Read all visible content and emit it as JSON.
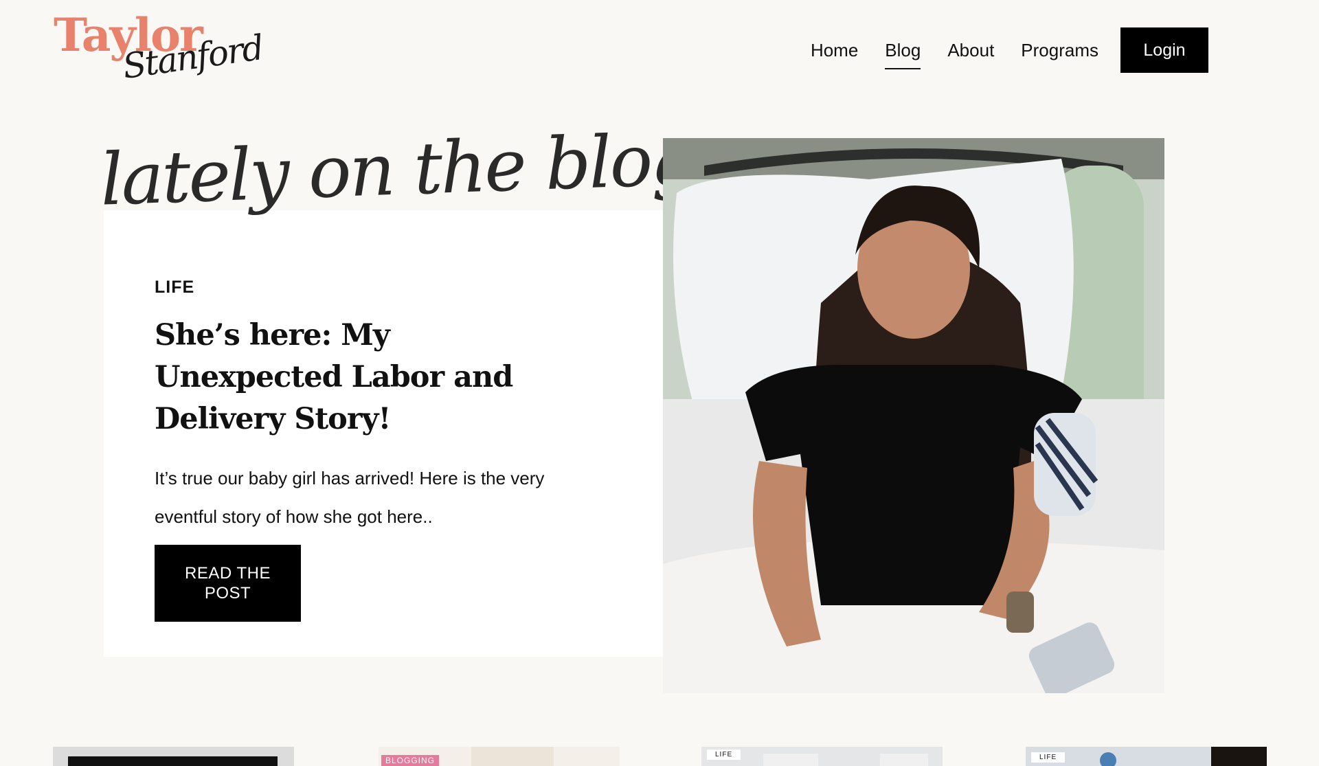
{
  "brand": {
    "logo_top": "Taylor",
    "logo_script": "Stanford",
    "accent_color": "#e8826c"
  },
  "nav": {
    "items": [
      {
        "label": "Home",
        "active": false
      },
      {
        "label": "Blog",
        "active": true
      },
      {
        "label": "About",
        "active": false
      },
      {
        "label": "Programs",
        "active": false
      }
    ],
    "login_label": "Login"
  },
  "featured": {
    "section_heading": "lately on the blog...",
    "category": "LIFE",
    "title": "She’s here: My Unexpected Labor and Delivery Story!",
    "excerpt": "It’s true our baby girl has arrived! Here is the very eventful story of how she got here..",
    "button_label": "READ THE POST",
    "image_icon": "hospital-bed-portrait-photo"
  },
  "thumbnails": [
    {
      "tag": ""
    },
    {
      "tag": "BLOGGING"
    },
    {
      "tag": "LIFE"
    },
    {
      "tag": "LIFE"
    }
  ]
}
